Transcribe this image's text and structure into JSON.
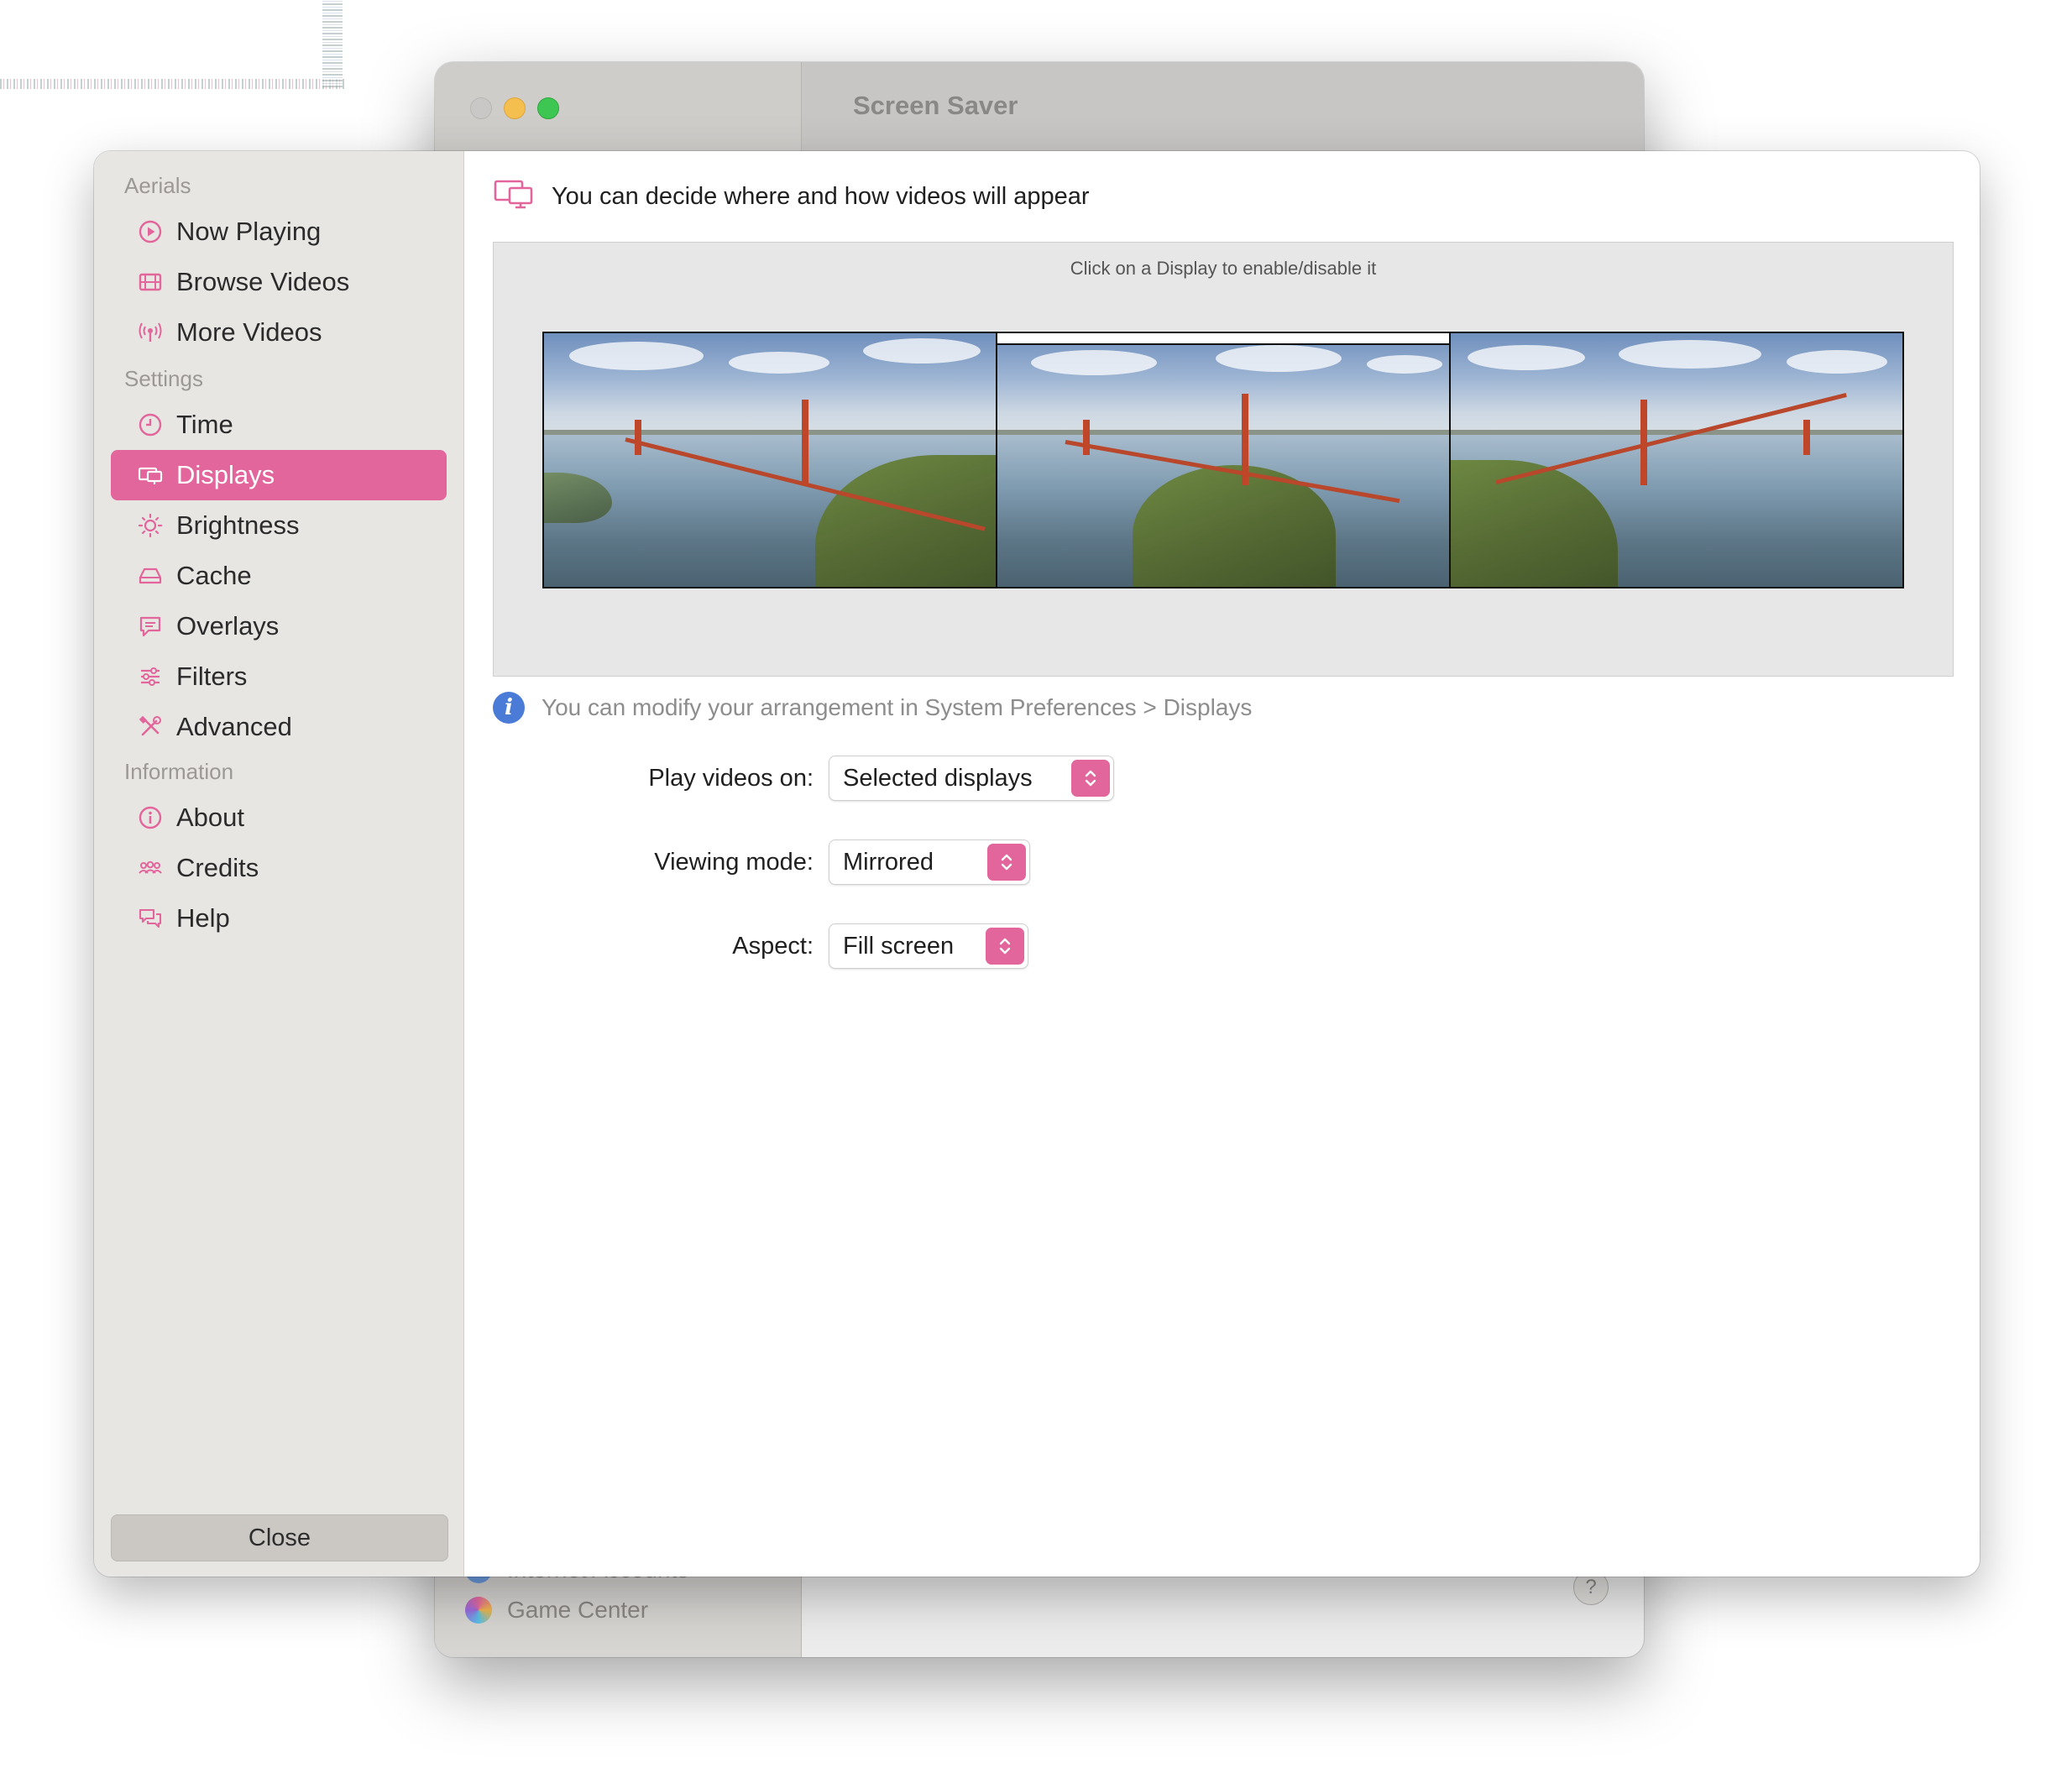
{
  "background_window": {
    "title": "Screen Saver",
    "sidebar_items": [
      {
        "label": "Internet Accounts"
      },
      {
        "label": "Game Center"
      }
    ],
    "help_label": "?"
  },
  "colors": {
    "accent": "#e2659b",
    "info_icon": "#4a7bd6"
  },
  "sidebar": {
    "sections": [
      {
        "title": "Aerials",
        "items": [
          {
            "label": "Now Playing",
            "icon": "play-circle-icon"
          },
          {
            "label": "Browse Videos",
            "icon": "film-icon"
          },
          {
            "label": "More Videos",
            "icon": "broadcast-icon"
          }
        ]
      },
      {
        "title": "Settings",
        "items": [
          {
            "label": "Time",
            "icon": "clock-icon"
          },
          {
            "label": "Displays",
            "icon": "displays-icon",
            "selected": true
          },
          {
            "label": "Brightness",
            "icon": "sun-icon"
          },
          {
            "label": "Cache",
            "icon": "drive-icon"
          },
          {
            "label": "Overlays",
            "icon": "message-icon"
          },
          {
            "label": "Filters",
            "icon": "sliders-icon"
          },
          {
            "label": "Advanced",
            "icon": "tools-icon"
          }
        ]
      },
      {
        "title": "Information",
        "items": [
          {
            "label": "About",
            "icon": "info-icon"
          },
          {
            "label": "Credits",
            "icon": "people-icon"
          },
          {
            "label": "Help",
            "icon": "help-bubble-icon"
          }
        ]
      }
    ],
    "close_label": "Close"
  },
  "main": {
    "header_text": "You can decide where and how videos will appear",
    "panel_hint": "Click on a Display to enable/disable it",
    "display_count": 3,
    "info_text": "You can modify your arrangement in System Preferences > Displays",
    "fields": [
      {
        "label": "Play videos on:",
        "value": "Selected displays"
      },
      {
        "label": "Viewing mode:",
        "value": "Mirrored"
      },
      {
        "label": "Aspect:",
        "value": "Fill screen"
      }
    ]
  }
}
